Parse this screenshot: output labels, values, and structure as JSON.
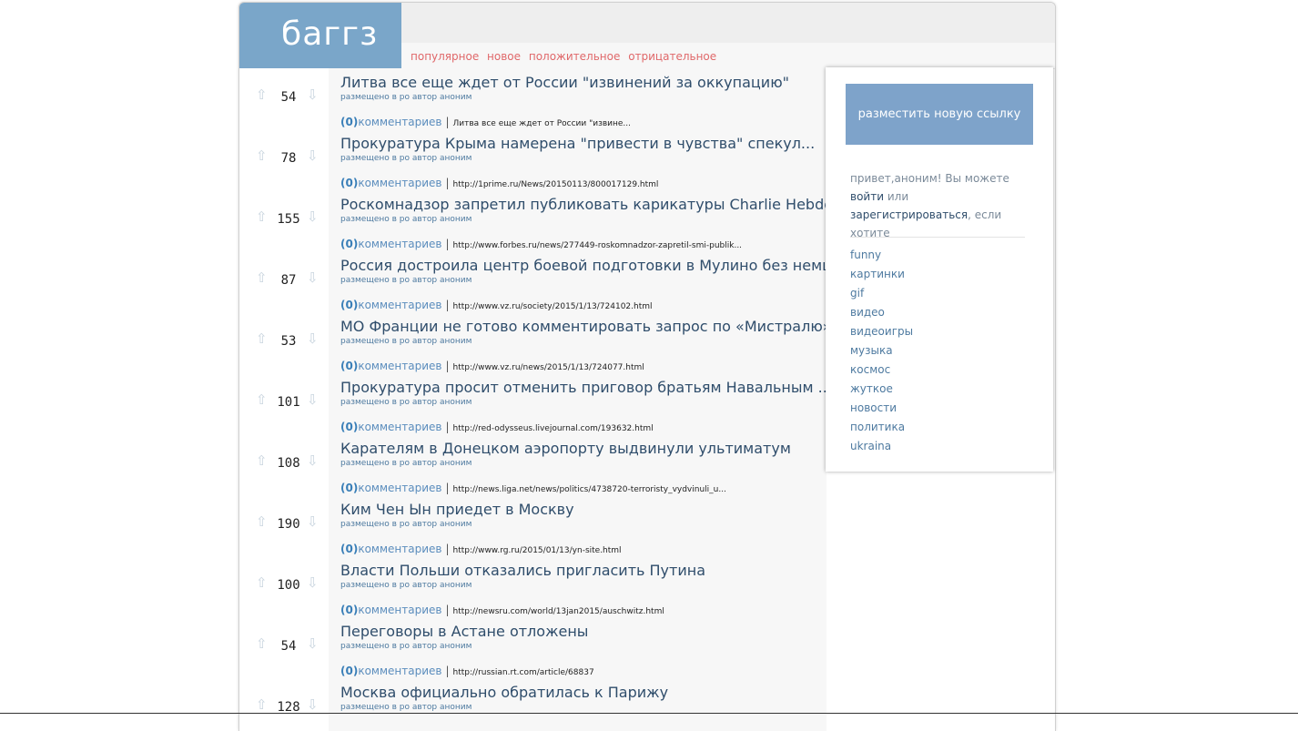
{
  "logo": "баггз",
  "tabs": [
    "популярное",
    "новое",
    "положительное",
    "отрицательное"
  ],
  "items": [
    {
      "score": "54",
      "title": "Литва все еще ждет от России \"извинений за оккупацию\"",
      "meta": "размещено в ро автор аноним",
      "comments_count": "(0)",
      "comments_label": "комментариев",
      "link": "Литва все еще ждет от России \"извине..."
    },
    {
      "score": "78",
      "title": "Прокуратура Крыма намерена \"привести в чувства\" спекул...",
      "meta": "размещено в ро автор аноним",
      "comments_count": "(0)",
      "comments_label": "комментариев",
      "link": "http://1prime.ru/News/20150113/800017129.html"
    },
    {
      "score": "155",
      "title": "Роскомнадзор запретил публиковать карикатуры Charlie Hebdo",
      "meta": "размещено в ро автор аноним",
      "comments_count": "(0)",
      "comments_label": "комментариев",
      "link": "http://www.forbes.ru/news/277449-roskomnadzor-zapretil-smi-publik..."
    },
    {
      "score": "87",
      "title": "Россия достроила центр боевой подготовки в Мулино без немце...",
      "meta": "размещено в ро автор аноним",
      "comments_count": "(0)",
      "comments_label": "комментариев",
      "link": "http://www.vz.ru/society/2015/1/13/724102.html"
    },
    {
      "score": "53",
      "title": "МО Франции не готово комментировать запрос по «Мистралю»",
      "meta": "размещено в ро автор аноним",
      "comments_count": "(0)",
      "comments_label": "комментариев",
      "link": "http://www.vz.ru/news/2015/1/13/724077.html"
    },
    {
      "score": "101",
      "title": "Прокуратура просит отменить приговор братьям Навальным ...",
      "meta": "размещено в ро автор аноним",
      "comments_count": "(0)",
      "comments_label": "комментариев",
      "link": "http://red-odysseus.livejournal.com/193632.html"
    },
    {
      "score": "108",
      "title": "Карателям в Донецком аэропорту выдвинули ультиматум",
      "meta": "размещено в ро автор аноним",
      "comments_count": "(0)",
      "comments_label": "комментариев",
      "link": "http://news.liga.net/news/politics/4738720-terroristy_vydvinuli_u..."
    },
    {
      "score": "190",
      "title": "Ким Чен Ын приедет в Москву",
      "meta": "размещено в ро автор аноним",
      "comments_count": "(0)",
      "comments_label": "комментариев",
      "link": "http://www.rg.ru/2015/01/13/yn-site.html"
    },
    {
      "score": "100",
      "title": "Власти Польши отказались пригласить Путина",
      "meta": "размещено в ро автор аноним",
      "comments_count": "(0)",
      "comments_label": "комментариев",
      "link": "http://newsru.com/world/13jan2015/auschwitz.html"
    },
    {
      "score": "54",
      "title": "Переговоры в Астане отложены",
      "meta": "размещено в ро автор аноним",
      "comments_count": "(0)",
      "comments_label": "комментариев",
      "link": "http://russian.rt.com/article/68837"
    },
    {
      "score": "128",
      "title": "Москва официально обратилась к Парижу",
      "meta": "размещено в ро автор аноним",
      "comments_count": "",
      "comments_label": "",
      "link": ""
    }
  ],
  "sidebar": {
    "post_button": "разместить новую ссылку",
    "greeting_prefix": "привет,аноним! Вы можете",
    "login": "войти",
    "or": "или",
    "register": "зарегистрироваться",
    "greeting_suffix": ", если хотите",
    "categories": [
      "funny",
      "картинки",
      "gif",
      "видео",
      "видеоигры",
      "музыка",
      "космос",
      "жуткое",
      "новости",
      "политика",
      "ukraina"
    ]
  },
  "icons": {
    "up": "up-arrow-icon",
    "down": "down-arrow-icon"
  }
}
